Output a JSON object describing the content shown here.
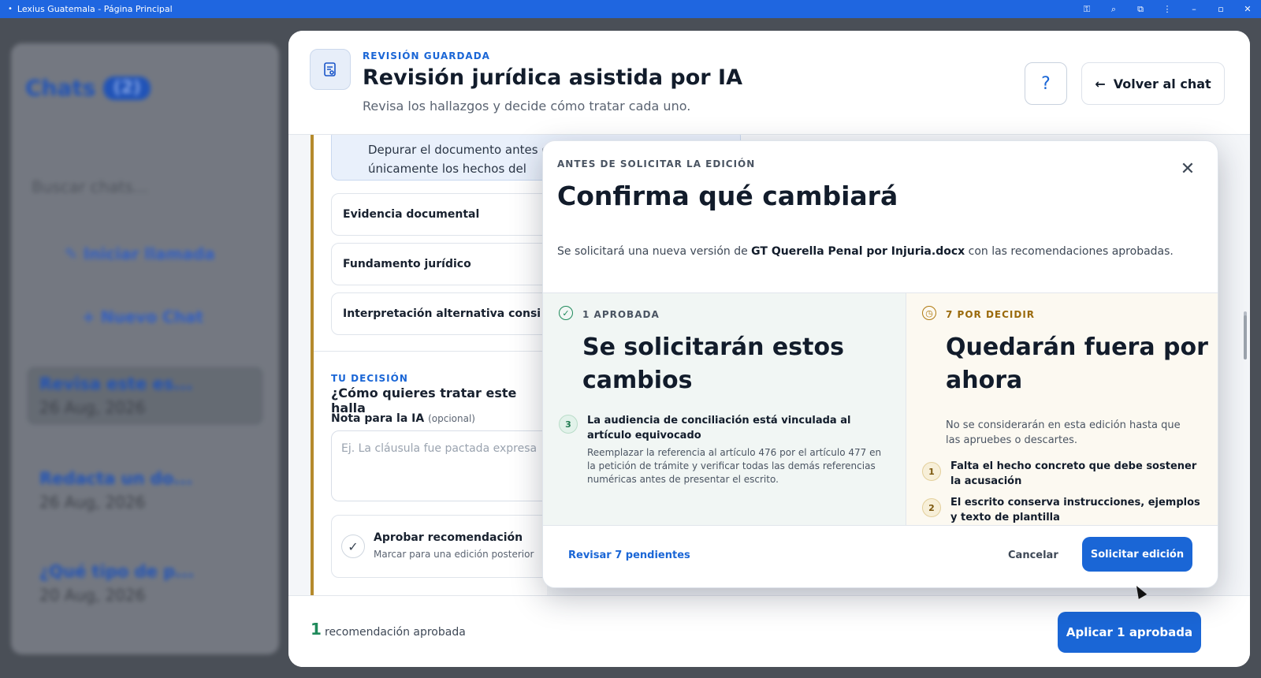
{
  "window": {
    "title": "Lexius Guatemala - Página Principal"
  },
  "sidebar": {
    "title": "Chats",
    "count": "(2)",
    "search_placeholder": "Buscar chats...",
    "start_call": "Iniciar llamada",
    "new_chat": "Nuevo Chat",
    "items": [
      {
        "title": "Revisa este es...",
        "date": "26 Aug, 2026"
      },
      {
        "title": "Redacta un do...",
        "date": "26 Aug, 2026"
      },
      {
        "title": "¿Qué tipo de p...",
        "date": "20 Aug, 2026"
      }
    ]
  },
  "header": {
    "kicker": "REVISIÓN GUARDADA",
    "title": "Revisión jurídica asistida por IA",
    "subtitle": "Revisa los hallazgos y decide cómo tratar cada uno.",
    "help_label": "?",
    "back_arrow": "←",
    "back_label": "Volver al chat"
  },
  "finding": {
    "note_line1": "Depurar el documento antes de firmarlo",
    "note_line2": "únicamente los hechos del",
    "sections": [
      "Evidencia documental",
      "Fundamento jurídico",
      "Interpretación alternativa consi"
    ],
    "decision_kicker": "TU DECISIÓN",
    "decision_question": "¿Cómo quieres tratar este halla",
    "note_label": "Nota para la IA",
    "note_optional": "(opcional)",
    "note_placeholder": "Ej. La cláusula fue pactada expresa",
    "approve_title": "Aprobar recomendación",
    "approve_sub": "Marcar para una edición posterior"
  },
  "footer": {
    "count": "1",
    "label": "recomendación aprobada",
    "apply_label": "Aplicar 1 aprobada"
  },
  "modal": {
    "kicker": "ANTES DE SOLICITAR LA EDICIÓN",
    "title": "Confirma qué cambiará",
    "close_label": "✕",
    "desc_pre": "Se solicitará una nueva versión de",
    "desc_file": "GT Querella Penal por Injuria.docx",
    "desc_post": "con las recomendaciones aprobadas.",
    "approved": {
      "kicker": "1 APROBADA",
      "title": "Se solicitarán estos cambios",
      "items": [
        {
          "num": "3",
          "title": "La audiencia de conciliación está vinculada al artículo equivocado",
          "body": "Reemplazar la referencia al artículo 476 por el artículo 477 en la petición de trámite y verificar todas las demás referencias numéricas antes de presentar el escrito."
        }
      ]
    },
    "pending": {
      "kicker": "7 POR DECIDIR",
      "title": "Quedarán fuera por ahora",
      "desc": "No se considerarán en esta edición hasta que las apruebes o descartes.",
      "items": [
        {
          "num": "1",
          "title": "Falta el hecho concreto que debe sostener la acusación"
        },
        {
          "num": "2",
          "title": "El escrito conserva instrucciones, ejemplos y texto de plantilla"
        }
      ]
    },
    "review_label": "Revisar 7 pendientes",
    "cancel_label": "Cancelar",
    "submit_label": "Solicitar edición"
  }
}
